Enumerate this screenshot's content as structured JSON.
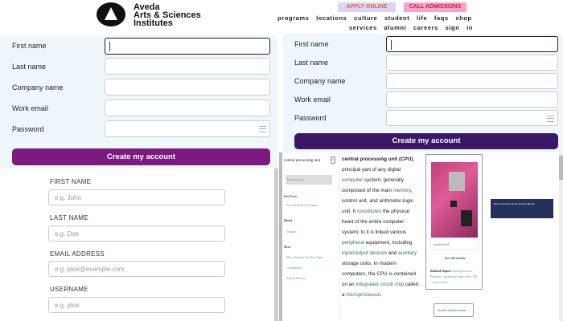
{
  "header": {
    "brand_line1": "Aveda",
    "brand_line2": "Arts & Sciences",
    "brand_line3": "Institutes",
    "apply": "APPLY ONLINE",
    "call": "CALL ADMISSIONS",
    "nav_row1": [
      "programs",
      "locations",
      "culture",
      "student life",
      "faqs",
      "shop"
    ],
    "nav_row2": [
      "services",
      "alumni",
      "careers",
      "sign in"
    ]
  },
  "form_a": {
    "fields": [
      "First name",
      "Last name",
      "Company name",
      "Work email",
      "Password"
    ],
    "button": "Create my account",
    "button_color": "#7d1a80"
  },
  "form_b": {
    "fields": [
      "First name",
      "Last name",
      "Company name",
      "Work email",
      "Password"
    ],
    "button": "Create my account",
    "button_color": "#3b1768"
  },
  "form_c": {
    "fields": [
      {
        "label": "FIRST NAME",
        "placeholder": "e.g. John"
      },
      {
        "label": "LAST NAME",
        "placeholder": "e.g. Doe"
      },
      {
        "label": "EMAIL ADDRESS",
        "placeholder": "e.g. jdoe@example.com"
      },
      {
        "label": "USERNAME",
        "placeholder": "e.g. jdoe"
      }
    ]
  },
  "article": {
    "sidebar_title": "central processing unit",
    "intro": "Introduction",
    "facts_heading": "Fast Facts",
    "facts_link": "Facts & Related Content",
    "media_heading": "Media",
    "media_link": "Images",
    "more_heading": "More",
    "more_links": [
      "More Articles On This Topic",
      "Contributors",
      "Article History"
    ],
    "t1": "central processing unit (CPU)",
    "t2": ", principal part of any digital ",
    "l1": "computer",
    "t3": " system, generally composed of the main ",
    "l2": "memory",
    "t4": ", control unit, and arithmetic-logic unit. It ",
    "l3": "constitutes",
    "t5": " the physical heart of the entire computer system; to it is linked various ",
    "l4": "peripheral",
    "t6": " equipment, including ",
    "l5": "input/output devices",
    "t7": " and ",
    "l6": "auxiliary",
    "t8": " storage units. In modern computers, the CPU is contained on an ",
    "l7": "integrated circuit chip",
    "t9": " called a ",
    "l8": "microprocessor",
    "t10": ".",
    "caption": "circuit board",
    "see_media": "See all media",
    "related_label": "Related Topics:",
    "related": "microprocessor • Pentium • arithmetic-logic unit • M1 • control unit",
    "see_related": "See all related content →",
    "ad": "Discover more about Abrams Brand"
  }
}
